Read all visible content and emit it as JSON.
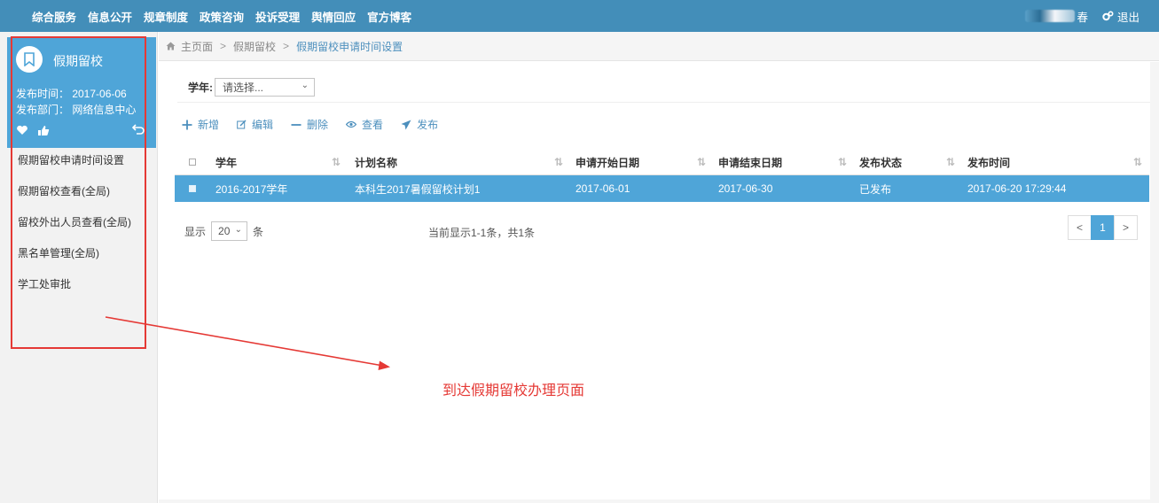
{
  "topnav": {
    "items": [
      "综合服务",
      "信息公开",
      "规章制度",
      "政策咨询",
      "投诉受理",
      "舆情回应",
      "官方博客"
    ],
    "user_name_visible": "春",
    "logout_label": "退出"
  },
  "sidebar": {
    "card": {
      "title": "假期留校",
      "publish_time": "发布时间： 2017-06-06",
      "publish_dept": "发布部门： 网络信息中心"
    },
    "menu": [
      "假期留校申请时间设置",
      "假期留校查看(全局)",
      "留校外出人员查看(全局)",
      "黑名单管理(全局)",
      "学工处审批"
    ]
  },
  "breadcrumb": {
    "home": "主页面",
    "level1": "假期留校",
    "current": "假期留校申请时间设置",
    "separator": ">"
  },
  "filter": {
    "label": "学年:",
    "select_value": "请选择..."
  },
  "toolbar": {
    "add": "新增",
    "edit": "编辑",
    "delete": "删除",
    "view": "查看",
    "publish": "发布"
  },
  "table": {
    "headers": [
      "学年",
      "计划名称",
      "申请开始日期",
      "申请结束日期",
      "发布状态",
      "发布时间"
    ],
    "rows": [
      [
        "2016-2017学年",
        "本科生2017暑假留校计划1",
        "2017-06-01",
        "2017-06-30",
        "已发布",
        "2017-06-20 17:29:44"
      ]
    ]
  },
  "footer": {
    "show_label": "显示",
    "page_size": "20",
    "unit_label": "条",
    "info": "当前显示1-1条，共1条",
    "pager": {
      "prev": "<",
      "current": "1",
      "next": ">"
    }
  },
  "annotation": {
    "text": "到达假期留校办理页面"
  },
  "colors": {
    "topbar": "#438eb9",
    "accent": "#4fa5d8",
    "link": "#4c8fbd",
    "annotation": "#e53935"
  }
}
